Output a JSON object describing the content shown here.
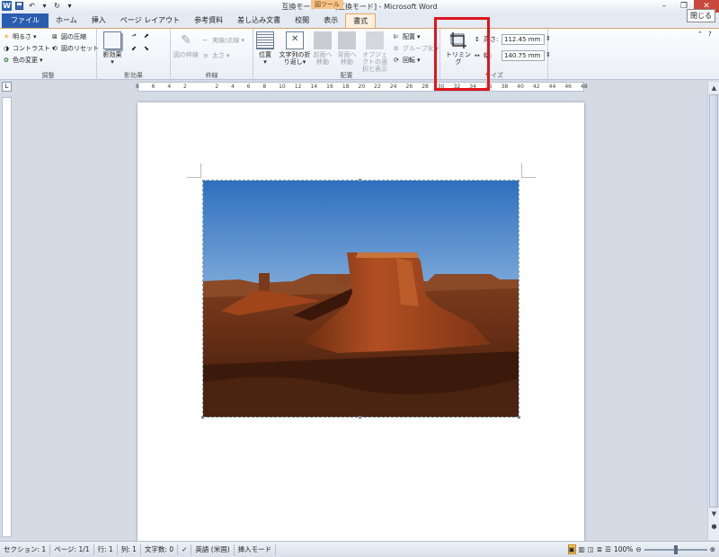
{
  "window": {
    "title": "互換モード.doc [互換モード] - Microsoft Word",
    "tooltip": "閉じる",
    "contextual_group": "図ツール"
  },
  "tabs": [
    "ファイル",
    "ホーム",
    "挿入",
    "ページ レイアウト",
    "参考資料",
    "差し込み文書",
    "校閲",
    "表示",
    "書式"
  ],
  "ribbon": {
    "adjust": {
      "label": "調整",
      "brightness": "明るさ",
      "contrast": "コントラスト",
      "recolor": "色の変更",
      "compress": "図の圧縮",
      "reset": "図のリセット"
    },
    "effects": {
      "label": "影効果",
      "shadow": "影効果"
    },
    "border": {
      "label": "枠線",
      "picture_border": "図の枠線",
      "dash": "実線/点線",
      "weight": "太さ"
    },
    "arrange": {
      "label": "配置",
      "position": "位置",
      "wrap": "文字列の折り返し",
      "forward": "前面へ移動",
      "backward": "背面へ移動",
      "selection": "オブジェクトの選択と表示",
      "align": "配置",
      "group": "グループ化",
      "rotate": "回転"
    },
    "size": {
      "label": "サイズ",
      "crop": "トリミング",
      "height_label": "高さ:",
      "height": "112.45 mm",
      "width_label": "幅:",
      "width": "140.75 mm"
    }
  },
  "ruler": {
    "ticks": [
      "8",
      "6",
      "4",
      "2",
      "",
      "2",
      "4",
      "6",
      "8",
      "10",
      "12",
      "14",
      "16",
      "18",
      "20",
      "22",
      "24",
      "26",
      "28",
      "30",
      "32",
      "34",
      "36",
      "38",
      "40",
      "42",
      "44",
      "46",
      "48"
    ]
  },
  "status": {
    "section": "セクション: 1",
    "page": "ページ: 1/1",
    "line": "行: 1",
    "column": "列: 1",
    "words": "文字数: 0",
    "language": "英語 (米国)",
    "mode": "挿入モード",
    "zoom": "100%"
  },
  "colors": {
    "file_tab": "#2a5cb0",
    "highlight": "#e0141c",
    "contextual": "#f6c48b"
  }
}
